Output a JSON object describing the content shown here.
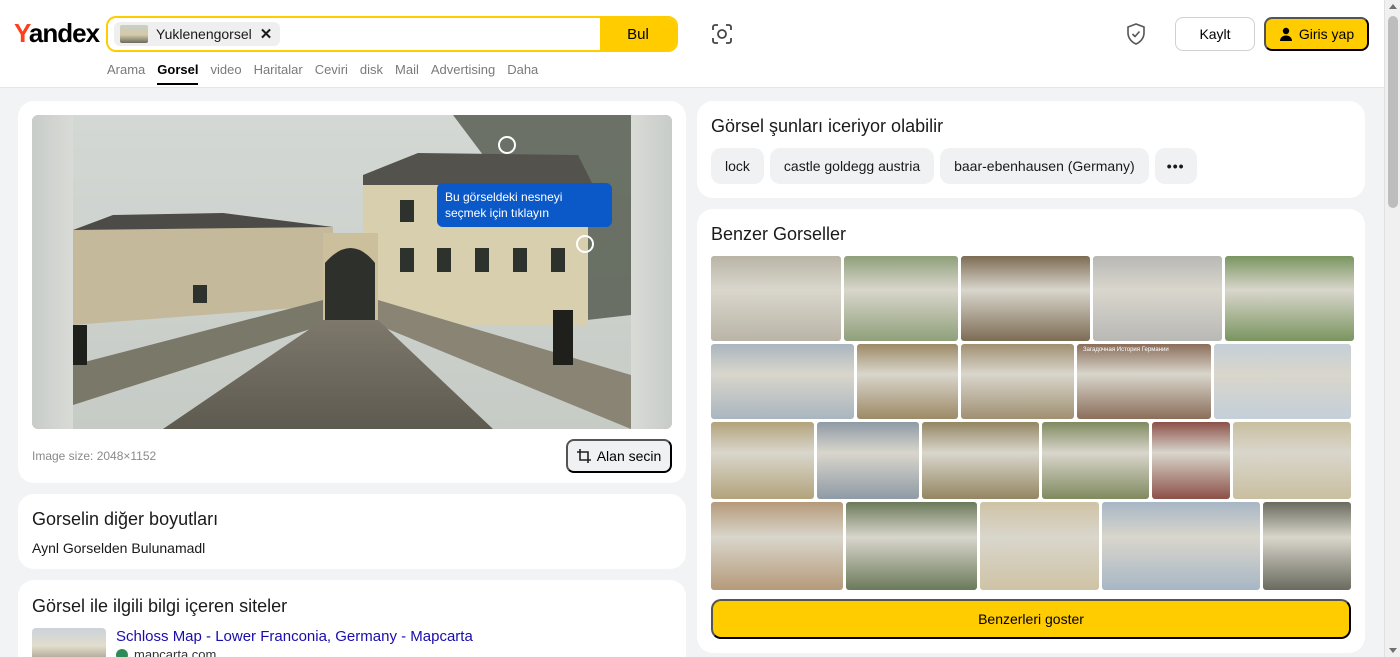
{
  "header": {
    "logo": {
      "first": "Y",
      "rest": "andex"
    },
    "search": {
      "chip_label": "Yuklenengorsel",
      "button": "Bul"
    },
    "register_button": "Kaylt",
    "login_button": "Giris yap",
    "tabs": [
      "Arama",
      "Gorsel",
      "video",
      "Haritalar",
      "Ceviri",
      "disk",
      "Mail",
      "Advertising",
      "Daha"
    ],
    "active_tab": "Gorsel"
  },
  "main_image": {
    "tooltip": "Bu görseldeki nesneyi seçmek için tıklayın",
    "image_size": "Image size: 2048×1152",
    "select_area_button": "Alan secin"
  },
  "other_sizes": {
    "title": "Gorselin diğer boyutları",
    "message": "Aynl Gorselden Bulunamadl"
  },
  "sites": {
    "title": "Görsel ile ilgili bilgi içeren siteler",
    "items": [
      {
        "title": "Schloss Map - Lower Franconia, Germany - Mapcarta",
        "host": "mapcarta.com"
      }
    ]
  },
  "contains": {
    "title": "Görsel şunları iceriyor olabilir",
    "tags": [
      "lock",
      "castle goldegg austria",
      "baar-ebenhausen (Germany)"
    ],
    "more": "•••"
  },
  "similar": {
    "title": "Benzer Gorseller",
    "show_button": "Benzerleri goster",
    "tile_colors": [
      [
        "#b9b4a6",
        "#8fa07a",
        "#7d6c54",
        "#b8b8b5",
        "#7a9560"
      ],
      [
        "#a9b5bf",
        "#9d8a66",
        "#a09072",
        "#8b6e5a",
        "#c4cfd8"
      ],
      [
        "#b2a37b",
        "#8e9aa5",
        "#948662",
        "#7f8a5f",
        "#8c5048",
        "#c9bfa0"
      ],
      [
        "#b59a7a",
        "#6b7a5a",
        "#cfc3a5",
        "#a7b6c5",
        "#6a6a5e",
        "#3a5aa0"
      ]
    ],
    "overlay_text": "Загадочная История Германии"
  },
  "colors": {
    "accent": "#ffcc00",
    "brand_red": "#fc3f1d",
    "link": "#1a0dab",
    "tooltip": "#0b59c9"
  }
}
